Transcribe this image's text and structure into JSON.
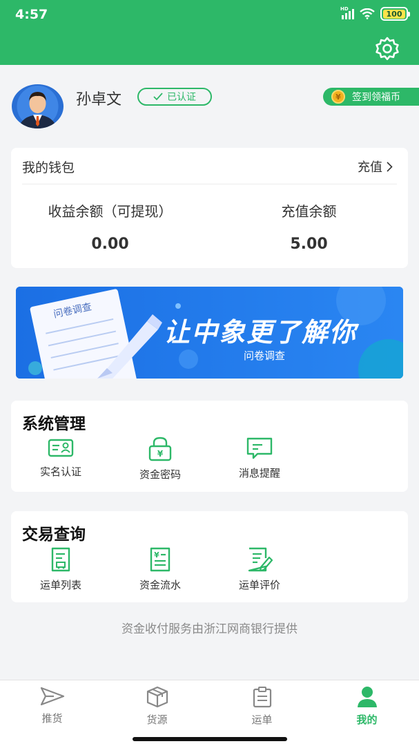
{
  "status_bar": {
    "time": "4:57",
    "network": "HD",
    "battery": "100"
  },
  "colors": {
    "brand": "#2db868",
    "banner": "#1f78e8"
  },
  "profile": {
    "name": "孙卓文",
    "verified_label": "已认证",
    "checkin_label": "签到领福币",
    "coin_symbol": "¥"
  },
  "wallet": {
    "title": "我的钱包",
    "recharge_label": "充值",
    "earnings_label": "收益余额（可提现）",
    "earnings_value": "0.00",
    "recharge_balance_label": "充值余额",
    "recharge_balance_value": "5.00"
  },
  "banner": {
    "card_label": "问卷调查",
    "title": "让中象更了解你",
    "subtitle": "问卷调查"
  },
  "system_management": {
    "title": "系统管理",
    "items": [
      {
        "label": "实名认证",
        "icon": "id-card-icon"
      },
      {
        "label": "资金密码",
        "icon": "lock-icon"
      },
      {
        "label": "消息提醒",
        "icon": "message-icon"
      }
    ]
  },
  "transaction_query": {
    "title": "交易查询",
    "items": [
      {
        "label": "运单列表",
        "icon": "waybill-list-icon"
      },
      {
        "label": "资金流水",
        "icon": "fund-flow-icon"
      },
      {
        "label": "运单评价",
        "icon": "waybill-review-icon"
      }
    ]
  },
  "footer_note": "资金收付服务由浙江网商银行提供",
  "tabs": [
    {
      "label": "推货",
      "icon": "send-icon",
      "active": false
    },
    {
      "label": "货源",
      "icon": "box-icon",
      "active": false
    },
    {
      "label": "运单",
      "icon": "clipboard-icon",
      "active": false
    },
    {
      "label": "我的",
      "icon": "person-icon",
      "active": true
    }
  ]
}
